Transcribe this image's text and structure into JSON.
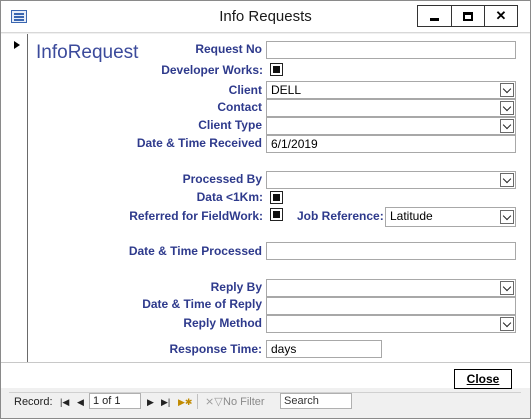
{
  "window": {
    "title": "Info Requests"
  },
  "form": {
    "title": "InfoRequest",
    "fields": {
      "request_no": {
        "label": "Request No",
        "value": ""
      },
      "developer_works": {
        "label": "Developer Works:",
        "checked": true
      },
      "client": {
        "label": "Client",
        "value": "DELL"
      },
      "contact": {
        "label": "Contact",
        "value": ""
      },
      "client_type": {
        "label": "Client Type",
        "value": ""
      },
      "date_received": {
        "label": "Date & Time Received",
        "value": "6/1/2019"
      },
      "processed_by": {
        "label": "Processed By",
        "value": ""
      },
      "data_1km": {
        "label": "Data <1Km:",
        "checked": true
      },
      "referred_fieldwork": {
        "label": "Referred for FieldWork:",
        "checked": true
      },
      "job_reference": {
        "label": "Job Reference:",
        "value": "Latitude"
      },
      "date_processed": {
        "label": "Date & Time Processed",
        "value": ""
      },
      "reply_by": {
        "label": "Reply By",
        "value": ""
      },
      "date_reply": {
        "label": "Date & Time of Reply",
        "value": ""
      },
      "reply_method": {
        "label": "Reply Method",
        "value": ""
      },
      "response_time": {
        "label": "Response Time:",
        "value": "days"
      }
    },
    "close_label": "Close"
  },
  "navbar": {
    "record_label": "Record:",
    "record_value": "1 of 1",
    "filter_label": "No Filter",
    "search_placeholder": "Search"
  }
}
